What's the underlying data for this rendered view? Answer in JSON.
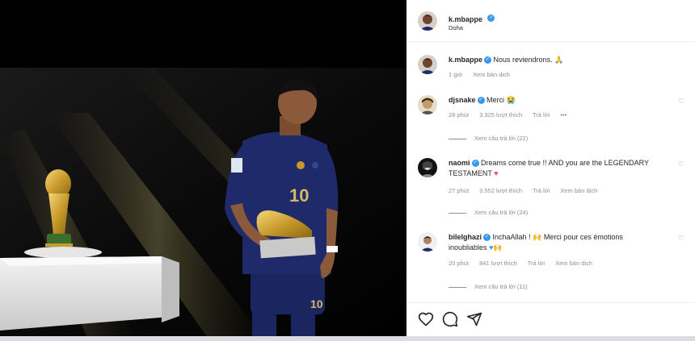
{
  "post": {
    "username": "k.mbappe",
    "location": "Doha",
    "caption": "Nous reviendrons.",
    "caption_time": "1 giờ",
    "caption_translate": "Xem bản dịch"
  },
  "comments": [
    {
      "username": "djsnake",
      "text": "Merci",
      "time": "28 phút",
      "likes": "3.325 lượt thích",
      "reply": "Trả lời",
      "more": "•••",
      "view_replies": "Xem câu trả lời (22)"
    },
    {
      "username": "naomi",
      "text": "Dreams come true !! AND you are the LEGENDARY",
      "text2": "TESTAMENT",
      "time": "27 phút",
      "likes": "3.552 lượt thích",
      "reply": "Trả lời",
      "translate": "Xem bản dịch",
      "view_replies": "Xem câu trả lời (24)"
    },
    {
      "username": "bilelghazi",
      "text": "InchaAllah !",
      "text_b": "Merci pour ces émotions",
      "text2": "inoubliables",
      "time": "20 phút",
      "likes": "841 lượt thích",
      "reply": "Trả lời",
      "translate": "Xem bản dịch",
      "view_replies": "Xem câu trả lời (11)"
    }
  ],
  "jersey_number": "10",
  "colors": {
    "verified": "#3897f0",
    "heart": "#ed4956",
    "jersey": "#1b2560"
  },
  "icons": [
    "like-icon",
    "comment-icon",
    "share-icon",
    "verified-icon",
    "pray-emoji",
    "heart-emoji",
    "blue-heart-emoji"
  ]
}
